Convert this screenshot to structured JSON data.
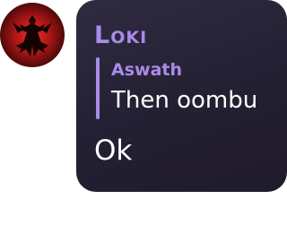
{
  "message": {
    "avatar_icon": "user-avatar-icon",
    "sender_name": "Loki",
    "reply": {
      "author": "Aswath",
      "text": "Then oombu"
    },
    "text": "Ok"
  },
  "colors": {
    "accent": "#a98be8",
    "bubble_background": "#262234",
    "text": "#ffffff",
    "avatar_red": "#c81e1e"
  }
}
